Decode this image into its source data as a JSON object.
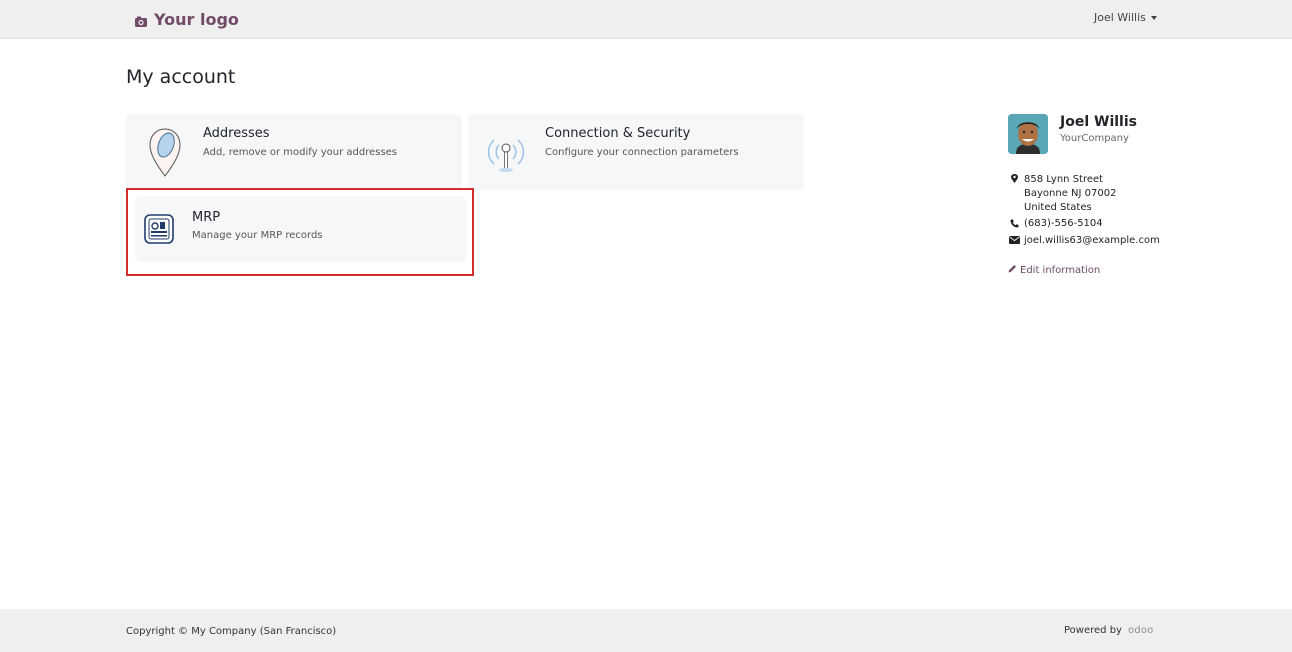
{
  "header": {
    "logo_text": "Your logo",
    "user_name": "Joel Willis"
  },
  "main": {
    "title": "My account",
    "cards": [
      {
        "title": "Addresses",
        "description": "Add, remove or modify your addresses",
        "icon": "map-pin-icon"
      },
      {
        "title": "Connection & Security",
        "description": "Configure your connection parameters",
        "icon": "antenna-icon"
      },
      {
        "title": "MRP",
        "description": "Manage your MRP records",
        "icon": "mrp-portal-icon"
      }
    ]
  },
  "profile": {
    "name": "Joel Willis",
    "company": "YourCompany",
    "address_lines": [
      "858 Lynn Street",
      "Bayonne NJ 07002",
      "United States"
    ],
    "phone": "(683)-556-5104",
    "email": "joel.willis63@example.com",
    "edit_label": "Edit information"
  },
  "footer": {
    "copyright": "Copyright © My Company (San Francisco)",
    "powered_by": "Powered by",
    "brand": "odoo"
  },
  "colors": {
    "brand": "#714b67",
    "highlight": "#d32f2f",
    "card_bg": "#f6f7f9"
  }
}
